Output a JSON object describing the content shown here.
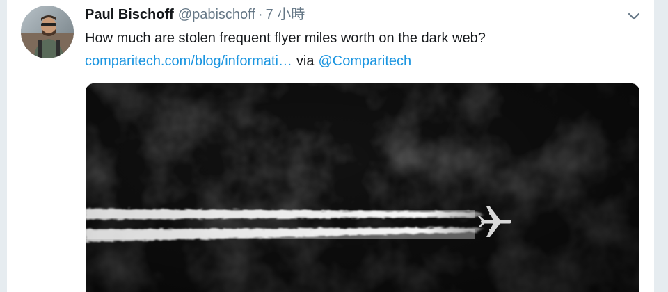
{
  "tweet": {
    "display_name": "Paul Bischoff",
    "handle": "@pabischoff",
    "separator": "·",
    "timestamp": "7 小時",
    "text": "How much are stolen frequent flyer miles worth on the dark web?",
    "link_text": "comparitech.com/blog/informati…",
    "via_text": "via",
    "mention": "@Comparitech",
    "menu_icon": "chevron-down-icon",
    "media_description_icon": "airplane-contrails-photo"
  },
  "colors": {
    "link": "#1b95e0",
    "name": "#14171a",
    "secondary": "#657786",
    "background": "#e6ecf0"
  }
}
